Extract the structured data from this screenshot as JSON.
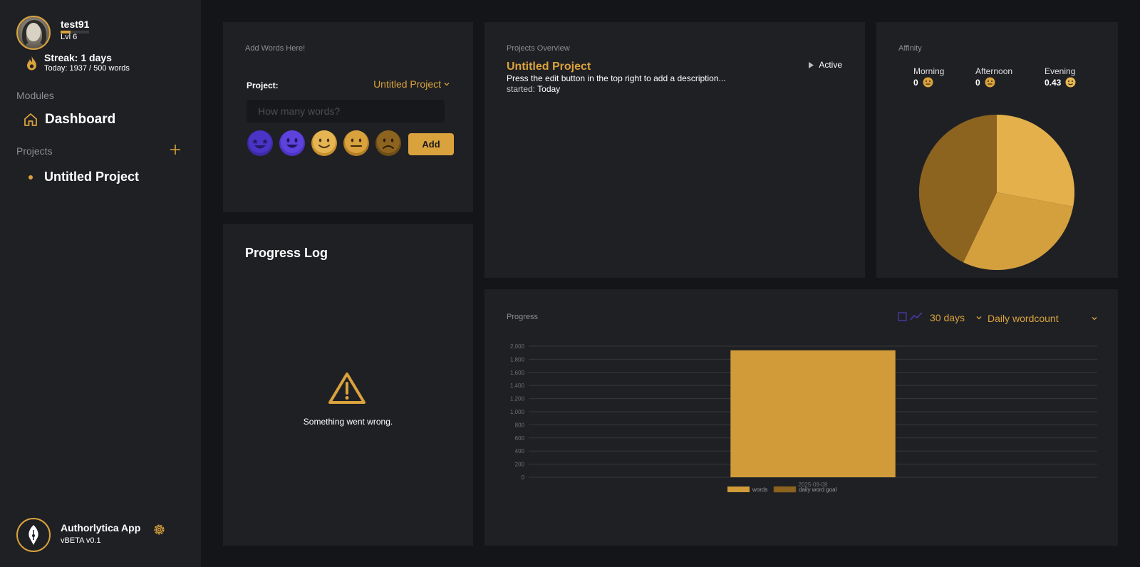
{
  "user": {
    "username": "test91",
    "level": "Lvl 6",
    "streak_title": "Streak: 1 days",
    "streak_today": "Today: 1937 / 500 words"
  },
  "sidebar": {
    "modules_label": "Modules",
    "dashboard_label": "Dashboard",
    "projects_label": "Projects",
    "projects": [
      {
        "label": "Untitled Project"
      }
    ]
  },
  "app": {
    "name": "Authorlytica App",
    "version": "vBETA v0.1"
  },
  "add_words": {
    "title": "Add Words Here!",
    "project_label": "Project:",
    "project_value": "Untitled Project",
    "input_placeholder": "How many words?",
    "moods": [
      "star-struck-emoji",
      "grinning-emoji",
      "smiling-emoji",
      "neutral-emoji",
      "frowning-emoji"
    ],
    "add_label": "Add"
  },
  "progress_log": {
    "title": "Progress Log",
    "error": "Something went wrong."
  },
  "overview": {
    "title": "Projects Overview",
    "project_name": "Untitled Project",
    "description": "Press the edit button in the top right to add a description...",
    "started_label": "started:",
    "started_value": "Today",
    "status": "Active"
  },
  "affinity": {
    "title": "Affinity",
    "periods": [
      {
        "label": "Morning",
        "value": "0"
      },
      {
        "label": "Afternoon",
        "value": "0"
      },
      {
        "label": "Evening",
        "value": "0.43"
      }
    ],
    "pie_colors": [
      "#e3b04b",
      "#d4a03e",
      "#8c6420"
    ]
  },
  "progress_chart": {
    "title": "Progress",
    "range_label": "30 days",
    "metric_label": "Daily wordcount"
  },
  "colors": {
    "accent": "#d9a23d",
    "background": "#141518",
    "panel": "#1f2024",
    "purple": "#5b3fd9"
  },
  "chart_data": {
    "type": "bar",
    "categories": [
      "2025-09-08"
    ],
    "series": [
      {
        "name": "words",
        "values": [
          1937
        ]
      },
      {
        "name": "daily word goal",
        "values": [
          500
        ]
      }
    ],
    "ylim": [
      0,
      2000
    ],
    "yticks": [
      "0",
      "200",
      "400",
      "600",
      "800",
      "1,000",
      "1,200",
      "1,400",
      "1,600",
      "1,800",
      "2,000"
    ],
    "grid": true,
    "legend": "bottom"
  }
}
